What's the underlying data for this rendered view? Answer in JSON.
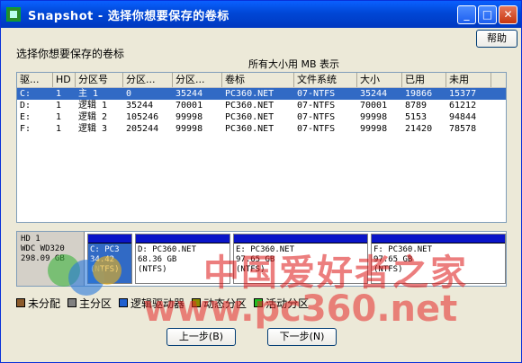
{
  "window": {
    "title": "Snapshot - 选择你想要保存的卷标",
    "minimize": "_",
    "maximize": "□",
    "close": "✕"
  },
  "help_label": "帮助",
  "prompt": "选择你想要保存的卷标",
  "units_note": "所有大小用 MB 表示",
  "table": {
    "headers": [
      "驱...",
      "HD",
      "分区号",
      "分区...",
      "分区...",
      "卷标",
      "文件系统",
      "大小",
      "已用",
      "未用"
    ],
    "rows": [
      [
        "C:",
        "1",
        "主   1",
        "0",
        "35244",
        "PC360.NET",
        "07-NTFS",
        "35244",
        "19866",
        "15377"
      ],
      [
        "D:",
        "1",
        "逻辑 1",
        "35244",
        "70001",
        "PC360.NET",
        "07-NTFS",
        "70001",
        "8789",
        "61212"
      ],
      [
        "E:",
        "1",
        "逻辑 2",
        "105246",
        "99998",
        "PC360.NET",
        "07-NTFS",
        "99998",
        "5153",
        "94844"
      ],
      [
        "F:",
        "1",
        "逻辑 3",
        "205244",
        "99998",
        "PC360.NET",
        "07-NTFS",
        "99998",
        "21420",
        "78578"
      ]
    ]
  },
  "disk": {
    "label": "HD 1",
    "model": "WDC WD320",
    "size": "298.09 GB",
    "partitions": [
      {
        "l1": "C: PC3",
        "l2": "34.42",
        "l3": "(NTFS)"
      },
      {
        "l1": "D: PC360.NET",
        "l2": "68.36 GB",
        "l3": "(NTFS)"
      },
      {
        "l1": "E: PC360.NET",
        "l2": "97.65 GB",
        "l3": "(NTFS)"
      },
      {
        "l1": "F: PC360.NET",
        "l2": "97.65 GB",
        "l3": "(NTFS)"
      }
    ]
  },
  "legend": [
    {
      "label": "未分配",
      "color": "#8b5a2b"
    },
    {
      "label": "主分区",
      "color": "#808080"
    },
    {
      "label": "逻辑驱动器",
      "color": "#2060d0"
    },
    {
      "label": "动态分区",
      "color": "#8b8b00"
    },
    {
      "label": "活动分区",
      "color": "#20c020"
    }
  ],
  "buttons": {
    "back": "上一步(B)",
    "next": "下一步(N)"
  },
  "watermark": {
    "cn": "中国爱好者之家",
    "url": "www.pc360.net"
  }
}
